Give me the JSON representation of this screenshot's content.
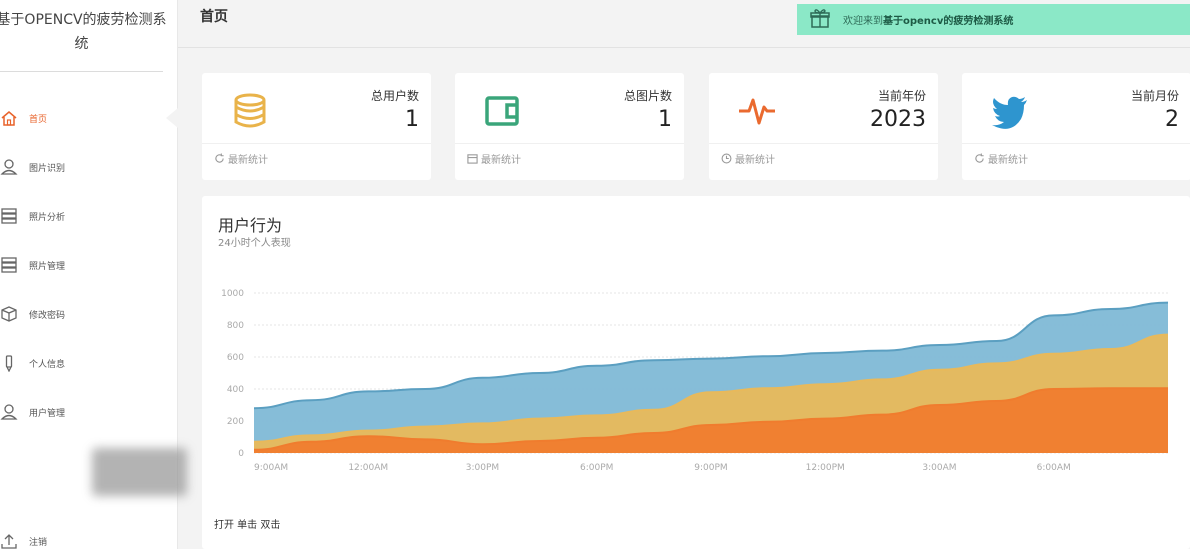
{
  "sidebar": {
    "brand": "基于OPENCV的疲劳检测系统",
    "items": [
      {
        "label": "首页",
        "icon": "home-icon",
        "active": true
      },
      {
        "label": "图片识别",
        "icon": "user-icon"
      },
      {
        "label": "照片分析",
        "icon": "server-icon"
      },
      {
        "label": "照片管理",
        "icon": "server-icon"
      },
      {
        "label": "修改密码",
        "icon": "box-icon"
      },
      {
        "label": "个人信息",
        "icon": "pen-icon"
      },
      {
        "label": "用户管理",
        "icon": "user-icon"
      }
    ],
    "logout": {
      "label": "注销",
      "icon": "upload-icon"
    }
  },
  "header": {
    "title": "首页",
    "welcome_prefix": "欢迎来到",
    "welcome_system": "基于opencv的疲劳检测系统"
  },
  "cards": [
    {
      "label": "总用户数",
      "value": "1",
      "footer": "最新统计",
      "icon": "database-icon",
      "footer_icon": "refresh-icon",
      "color": "#e9b34a"
    },
    {
      "label": "总图片数",
      "value": "1",
      "footer": "最新统计",
      "icon": "wallet-icon",
      "footer_icon": "calendar-icon",
      "color": "#3aa57a"
    },
    {
      "label": "当前年份",
      "value": "2023",
      "footer": "最新统计",
      "icon": "pulse-icon",
      "footer_icon": "clock-icon",
      "color": "#ea6a2f"
    },
    {
      "label": "当前月份",
      "value": "2",
      "footer": "最新统计",
      "icon": "twitter-icon",
      "footer_icon": "refresh-icon",
      "color": "#2e95cf"
    }
  ],
  "chart": {
    "title": "用户行为",
    "subtitle": "24小时个人表现",
    "events_label": "打开 单击 双击"
  },
  "chart_data": {
    "type": "area",
    "stacked": false,
    "categories": [
      "9:00AM",
      "12:00AM",
      "3:00PM",
      "6:00PM",
      "9:00PM",
      "12:00PM",
      "3:00AM",
      "6:00AM"
    ],
    "x": [
      0,
      0.5,
      1,
      1.5,
      2,
      2.5,
      3,
      3.5,
      4,
      4.5,
      5,
      5.5,
      6,
      6.5,
      7,
      7.5,
      8
    ],
    "ylim": [
      0,
      1000
    ],
    "yticks": [
      0,
      200,
      400,
      600,
      800,
      1000
    ],
    "grid": true,
    "series": [
      {
        "values": [
          280,
          330,
          385,
          400,
          470,
          500,
          545,
          580,
          590,
          605,
          625,
          640,
          675,
          700,
          860,
          900,
          940
        ],
        "color": "#7fb9d6"
      },
      {
        "values": [
          70,
          110,
          140,
          165,
          185,
          215,
          235,
          270,
          380,
          405,
          430,
          460,
          520,
          560,
          620,
          650,
          740
        ],
        "color": "#e8b95b"
      },
      {
        "values": [
          20,
          70,
          105,
          85,
          55,
          75,
          95,
          125,
          175,
          195,
          215,
          240,
          300,
          325,
          400,
          405,
          405
        ],
        "color": "#f07c2e"
      }
    ],
    "colors": {
      "grid": "#e4e4e4",
      "axis_text": "#aaaaaa",
      "line_blue": "#5b9fc1"
    }
  }
}
